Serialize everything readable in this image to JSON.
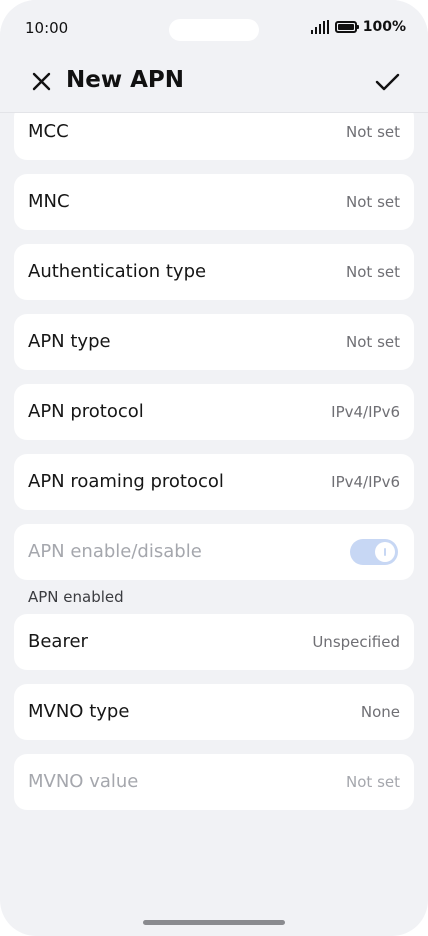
{
  "status_bar": {
    "time": "10:00",
    "battery": "100%"
  },
  "app_bar": {
    "title": "New APN"
  },
  "rows": [
    {
      "label": "MCC",
      "value": "Not set"
    },
    {
      "label": "MNC",
      "value": "Not set"
    },
    {
      "label": "Authentication type",
      "value": "Not set"
    },
    {
      "label": "APN type",
      "value": "Not set"
    },
    {
      "label": "APN protocol",
      "value": "IPv4/IPv6"
    },
    {
      "label": "APN roaming protocol",
      "value": "IPv4/IPv6"
    }
  ],
  "apn_toggle": {
    "label": "APN enable/disable",
    "hint": "APN enabled",
    "state": "on"
  },
  "rows_after": [
    {
      "label": "Bearer",
      "value": "Unspecified"
    },
    {
      "label": "MVNO type",
      "value": "None"
    },
    {
      "label": "MVNO value",
      "value": "Not set"
    }
  ],
  "colors": {
    "background": "#f1f2f5",
    "card": "#ffffff",
    "toggle_track": "#c7d7f4",
    "disabled_text": "#a5a7ad"
  }
}
